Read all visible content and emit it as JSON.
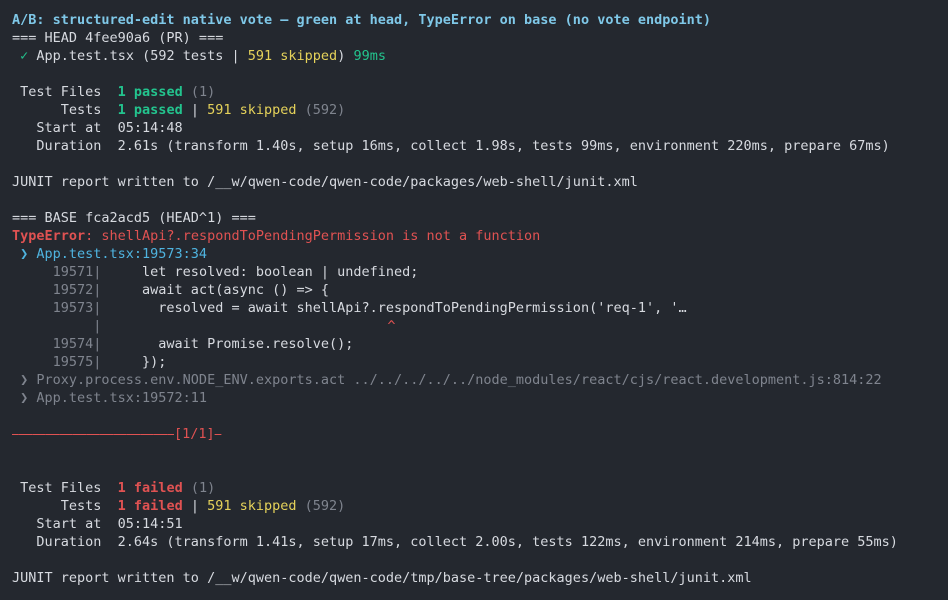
{
  "title": "A/B: structured-edit native vote — green at head, TypeError on base (no vote endpoint)",
  "head": {
    "header": "=== HEAD 4fee90a6 (PR) ===",
    "check": "✓",
    "file": "App.test.tsx",
    "tests_open": "(592 tests | ",
    "skipped": "591 skipped",
    "tests_close": ")",
    "time": "99ms",
    "summary": {
      "files_label": " Test Files  ",
      "files_passed": "1 passed",
      "files_total": " (1)",
      "tests_label": "      Tests  ",
      "tests_passed": "1 passed",
      "sep": " | ",
      "tests_skipped": "591 skipped",
      "tests_total": " (592)",
      "start": "   Start at  05:14:48",
      "duration": "   Duration  2.61s (transform 1.40s, setup 16ms, collect 1.98s, tests 99ms, environment 220ms, prepare 67ms)"
    },
    "junit": "JUNIT report written to /__w/qwen-code/qwen-code/packages/web-shell/junit.xml"
  },
  "base": {
    "header": "=== BASE fca2acd5 (HEAD^1) ===",
    "error_type": "TypeError",
    "error_msg": ": shellApi?.respondToPendingPermission is not a function",
    "location": " ❯ App.test.tsx:19573:34",
    "code": [
      {
        "num": "     19571|",
        "text": "     let resolved: boolean | undefined;"
      },
      {
        "num": "     19572|",
        "text": "     await act(async () => {"
      },
      {
        "num": "     19573|",
        "text": "       resolved = await shellApi?.respondToPendingPermission('req-1', '…"
      },
      {
        "num": "          |",
        "text": ""
      },
      {
        "num": "     19574|",
        "text": "       await Promise.resolve();"
      },
      {
        "num": "     19575|",
        "text": "     });"
      }
    ],
    "caret": "^",
    "stack": [
      " ❯ Proxy.process.env.NODE_ENV.exports.act ../../../../../node_modules/react/cjs/react.development.js:814:22",
      " ❯ App.test.tsx:19572:11"
    ],
    "divider": "⎯⎯⎯⎯⎯⎯⎯⎯⎯⎯⎯⎯⎯⎯⎯⎯⎯⎯⎯⎯⎯⎯⎯⎯[1/1]⎯",
    "summary": {
      "files_label": " Test Files  ",
      "files_failed": "1 failed",
      "files_total": " (1)",
      "tests_label": "      Tests  ",
      "tests_failed": "1 failed",
      "sep": " | ",
      "tests_skipped": "591 skipped",
      "tests_total": " (592)",
      "start": "   Start at  05:14:51",
      "duration": "   Duration  2.64s (transform 1.41s, setup 17ms, collect 2.00s, tests 122ms, environment 214ms, prepare 55ms)"
    },
    "junit": "JUNIT report written to /__w/qwen-code/qwen-code/tmp/base-tree/packages/web-shell/junit.xml"
  }
}
